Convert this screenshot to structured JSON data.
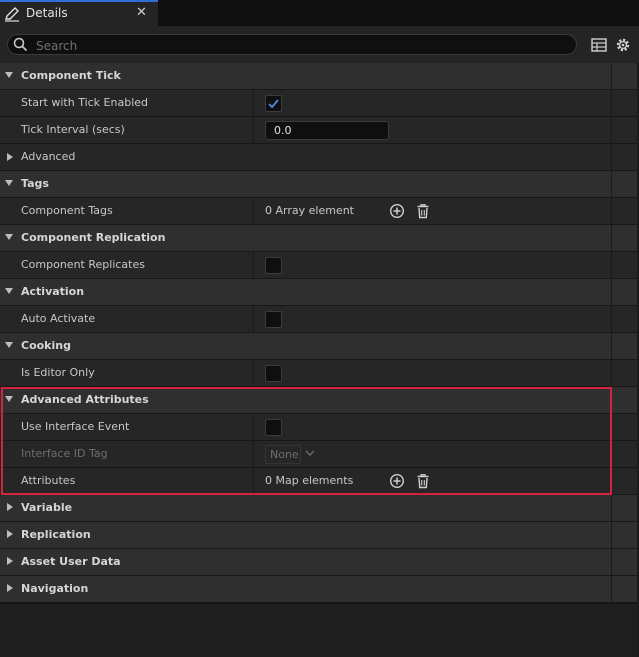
{
  "tab": {
    "title": "Details",
    "close": "✕"
  },
  "search": {
    "placeholder": "Search",
    "value": ""
  },
  "toolbar": {
    "grid_icon": "table-icon",
    "settings_icon": "gear-icon"
  },
  "sections": {
    "component_tick": {
      "title": "Component Tick",
      "start_with_tick_label": "Start with Tick Enabled",
      "start_with_tick_checked": true,
      "tick_interval_label": "Tick Interval (secs)",
      "tick_interval_value": "0.0",
      "advanced_label": "Advanced"
    },
    "tags": {
      "title": "Tags",
      "component_tags_label": "Component Tags",
      "component_tags_value": "0 Array element"
    },
    "replication": {
      "title": "Component Replication",
      "replicates_label": "Component Replicates",
      "replicates_checked": false
    },
    "activation": {
      "title": "Activation",
      "auto_activate_label": "Auto Activate",
      "auto_activate_checked": false
    },
    "cooking": {
      "title": "Cooking",
      "editor_only_label": "Is Editor Only",
      "editor_only_checked": false
    },
    "advanced_attributes": {
      "title": "Advanced Attributes",
      "use_interface_label": "Use Interface Event",
      "use_interface_checked": false,
      "interface_id_label": "Interface ID Tag",
      "interface_id_value": "None",
      "attributes_label": "Attributes",
      "attributes_value": "0 Map elements"
    },
    "collapsed": [
      "Variable",
      "Replication",
      "Asset User Data",
      "Navigation"
    ]
  },
  "colors": {
    "accent": "#2f6fd8",
    "highlight": "#d0243f",
    "check": "#4a8de0"
  }
}
